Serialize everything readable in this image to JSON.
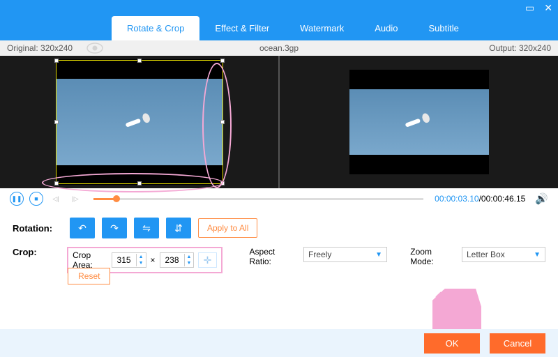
{
  "window": {
    "minimize": "▭",
    "close": "✕"
  },
  "tabs": {
    "items": [
      "Rotate & Crop",
      "Effect & Filter",
      "Watermark",
      "Audio",
      "Subtitle"
    ],
    "active": 0
  },
  "info": {
    "original_label": "Original:",
    "original": "320x240",
    "filename": "ocean.3gp",
    "output_label": "Output:",
    "output": "320x240"
  },
  "playback": {
    "current": "00:00:03.10",
    "total": "00:00:46.15",
    "sep": "/"
  },
  "rotation": {
    "label": "Rotation:",
    "apply_all": "Apply to All"
  },
  "crop": {
    "label": "Crop:",
    "area_label": "Crop Area:",
    "w": "315",
    "h": "238",
    "times": "×",
    "reset": "Reset"
  },
  "aspect": {
    "label": "Aspect Ratio:",
    "value": "Freely"
  },
  "zoom": {
    "label": "Zoom Mode:",
    "value": "Letter Box"
  },
  "buttons": {
    "ok": "OK",
    "cancel": "Cancel"
  }
}
